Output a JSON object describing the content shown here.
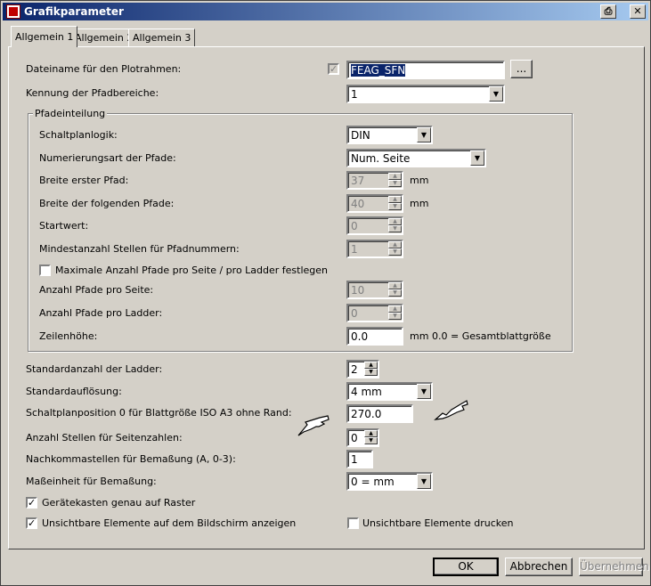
{
  "window": {
    "title": "Grafikparameter"
  },
  "tabs": [
    {
      "label": "Allgemein 1",
      "active": true
    },
    {
      "label": "Allgemein 2",
      "active": false
    },
    {
      "label": "Allgemein 3",
      "active": false
    }
  ],
  "fields": {
    "dateiname": {
      "label": "Dateiname für den Plotrahmen:",
      "value": "FEAG_SFN",
      "browse": "..."
    },
    "kennung": {
      "label": "Kennung der Pfadbereiche:",
      "value": "1"
    },
    "pfadeinteilung": {
      "title": "Pfadeinteilung",
      "schaltplanlogik": {
        "label": "Schaltplanlogik:",
        "value": "DIN"
      },
      "numerierungsart": {
        "label": "Numerierungsart der Pfade:",
        "value": "Num. Seite"
      },
      "breite_erster": {
        "label": "Breite erster Pfad:",
        "value": "37",
        "unit": "mm"
      },
      "breite_folgende": {
        "label": "Breite der folgenden Pfade:",
        "value": "40",
        "unit": "mm"
      },
      "startwert": {
        "label": "Startwert:",
        "value": "0"
      },
      "mindestanzahl": {
        "label": "Mindestanzahl Stellen für Pfadnummern:",
        "value": "1"
      },
      "maximale": {
        "label": "Maximale Anzahl Pfade pro Seite / pro Ladder festlegen",
        "checked": false
      },
      "pfade_seite": {
        "label": "Anzahl Pfade pro Seite:",
        "value": "10"
      },
      "pfade_ladder": {
        "label": "Anzahl Pfade pro Ladder:",
        "value": "0"
      },
      "zeilenhoehe": {
        "label": "Zeilenhöhe:",
        "value": "0.0",
        "unit": "mm",
        "hint": "0.0 = Gesamtblattgröße"
      }
    },
    "standardanzahl": {
      "label": "Standardanzahl der Ladder:",
      "value": "2"
    },
    "standardaufloesung": {
      "label": "Standardauflösung:",
      "value": "4 mm"
    },
    "schaltplanposition": {
      "label": "Schaltplanposition 0 für Blattgröße ISO A3 ohne Rand:",
      "value": "270.0"
    },
    "stellen_seitenzahlen": {
      "label": "Anzahl Stellen für Seitenzahlen:",
      "value": "0"
    },
    "nachkommastellen": {
      "label": "Nachkommastellen für Bemaßung (A, 0-3):",
      "value": "1"
    },
    "masseinheit": {
      "label": "Maßeinheit für Bemaßung:",
      "value": "0 = mm"
    },
    "geraetekasten": {
      "label": "Gerätekasten genau auf Raster",
      "checked": true
    },
    "unsichtbare_anzeigen": {
      "label": "Unsichtbare Elemente auf dem Bildschirm anzeigen",
      "checked": true
    },
    "unsichtbare_drucken": {
      "label": "Unsichtbare Elemente drucken",
      "checked": false
    }
  },
  "buttons": {
    "ok": "OK",
    "abbrechen": "Abbrechen",
    "uebernehmen": "Übernehmen"
  },
  "icons": {
    "app": "app-icon",
    "print": "print-icon",
    "close": "close-icon",
    "pointer": "hand-pointer-icon"
  }
}
